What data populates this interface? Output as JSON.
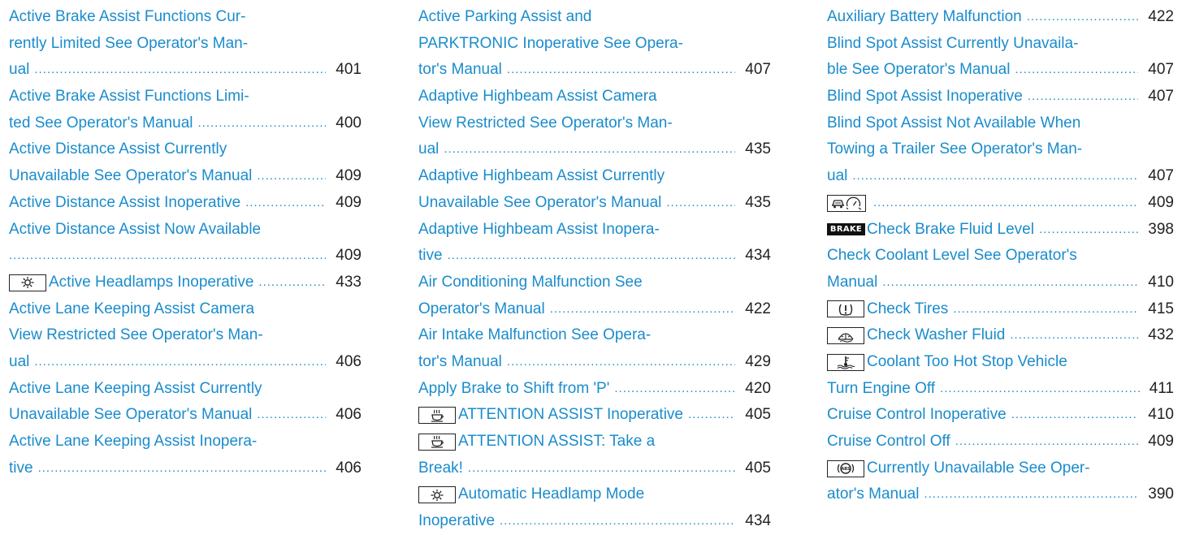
{
  "columns": [
    {
      "entries": [
        {
          "lines": [
            "Active Brake Assist Functions Cur-",
            "rently Limited See Operator's Man-",
            "ual"
          ],
          "page": "401"
        },
        {
          "lines": [
            "Active Brake Assist Functions Limi-",
            "ted See Operator's Manual"
          ],
          "page": "400"
        },
        {
          "lines": [
            "Active Distance Assist Currently",
            "Unavailable See Operator's Manual"
          ],
          "page": "409"
        },
        {
          "lines": [
            "Active Distance Assist Inoperative"
          ],
          "page": "409"
        },
        {
          "lines": [
            "Active Distance Assist Now Available",
            ""
          ],
          "page": "409"
        },
        {
          "icon": "headlamp-icon",
          "lines": [
            "Active Headlamps Inoperative"
          ],
          "page": "433"
        },
        {
          "lines": [
            "Active Lane Keeping Assist Camera",
            "View Restricted See Operator's Man-",
            "ual"
          ],
          "page": "406"
        },
        {
          "lines": [
            "Active Lane Keeping Assist Currently",
            "Unavailable See Operator's Manual"
          ],
          "page": "406"
        },
        {
          "lines": [
            "Active Lane Keeping Assist Inopera-",
            "tive"
          ],
          "page": "406"
        }
      ]
    },
    {
      "entries": [
        {
          "lines": [
            "Active Parking Assist and",
            "PARKTRONIC Inoperative See Opera-",
            "tor's Manual"
          ],
          "page": "407"
        },
        {
          "lines": [
            "Adaptive Highbeam Assist Camera",
            "View Restricted See Operator's Man-",
            "ual"
          ],
          "page": "435"
        },
        {
          "lines": [
            "Adaptive Highbeam Assist Currently",
            "Unavailable See Operator's Manual"
          ],
          "page": "435"
        },
        {
          "lines": [
            "Adaptive Highbeam Assist Inopera-",
            "tive"
          ],
          "page": "434"
        },
        {
          "lines": [
            "Air Conditioning Malfunction See",
            "Operator's Manual"
          ],
          "page": "422"
        },
        {
          "lines": [
            "Air Intake Malfunction See Opera-",
            "tor's Manual"
          ],
          "page": "429"
        },
        {
          "lines": [
            "Apply Brake to Shift from 'P'"
          ],
          "page": "420"
        },
        {
          "icon": "coffee-cup-icon",
          "lines": [
            "ATTENTION ASSIST Inoperative"
          ],
          "page": "405"
        },
        {
          "icon": "coffee-cup-icon",
          "lines": [
            "ATTENTION ASSIST: Take a",
            "Break!"
          ],
          "page": "405"
        },
        {
          "icon": "headlamp-icon",
          "lines": [
            "Automatic Headlamp Mode",
            "Inoperative"
          ],
          "page": "434"
        }
      ]
    },
    {
      "entries": [
        {
          "lines": [
            "Auxiliary Battery Malfunction"
          ],
          "page": "422"
        },
        {
          "lines": [
            "Blind Spot Assist Currently Unavaila-",
            "ble See Operator's Manual"
          ],
          "page": "407"
        },
        {
          "lines": [
            "Blind Spot Assist Inoperative"
          ],
          "page": "407"
        },
        {
          "lines": [
            "Blind Spot Assist Not Available When",
            "Towing a Trailer See Operator's Man-",
            "ual"
          ],
          "page": "407"
        },
        {
          "icon": "distance-speedometer-icon",
          "lines": [
            ""
          ],
          "page": "409"
        },
        {
          "icon": "brake-text-icon",
          "iconText": "BRAKE",
          "lines": [
            "Check Brake Fluid Level"
          ],
          "page": "398"
        },
        {
          "lines": [
            "Check Coolant Level See Operator's",
            "Manual"
          ],
          "page": "410"
        },
        {
          "icon": "tire-pressure-icon",
          "lines": [
            "Check Tires"
          ],
          "page": "415"
        },
        {
          "icon": "washer-fluid-icon",
          "lines": [
            "Check Washer Fluid"
          ],
          "page": "432"
        },
        {
          "icon": "coolant-temperature-icon",
          "lines": [
            "Coolant Too Hot Stop Vehicle",
            "Turn Engine Off"
          ],
          "page": "411"
        },
        {
          "lines": [
            "Cruise Control Inoperative"
          ],
          "page": "410"
        },
        {
          "lines": [
            "Cruise Control Off"
          ],
          "page": "409"
        },
        {
          "icon": "abs-icon",
          "lines": [
            "Currently Unavailable See Oper-",
            "ator's Manual"
          ],
          "page": "390"
        }
      ]
    }
  ],
  "colors": {
    "link": "#1a8ccc",
    "page_number": "#222222"
  }
}
